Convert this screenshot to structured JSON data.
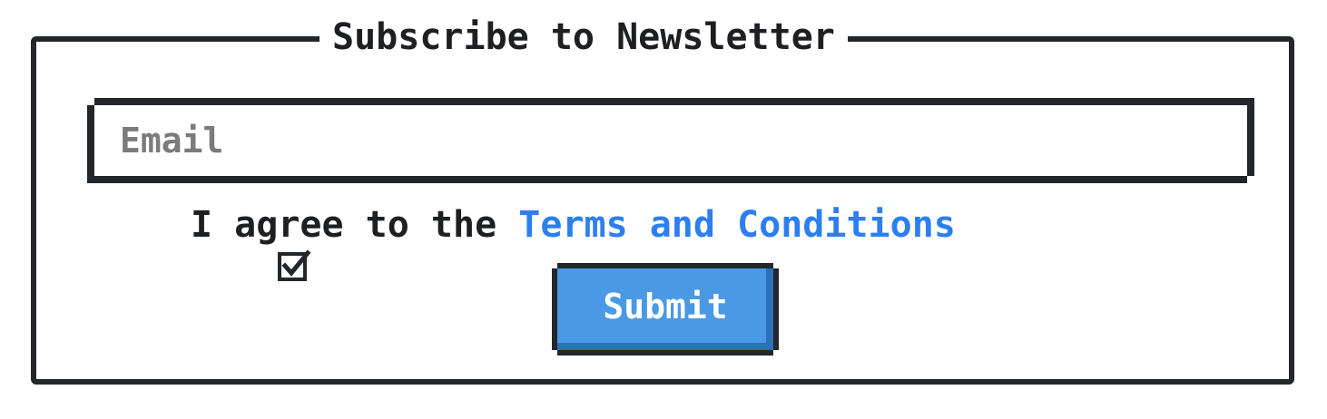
{
  "form": {
    "legend": "Subscribe to Newsletter",
    "email": {
      "placeholder": "Email",
      "value": ""
    },
    "agree": {
      "checked": true,
      "text_prefix": "I agree to the ",
      "link_text": "Terms and Conditions"
    },
    "submit_label": "Submit"
  },
  "colors": {
    "border": "#23262b",
    "link": "#2d7ff0",
    "button": "#4a99e4",
    "button_shade": "#2d6fb8",
    "placeholder": "#7b7b7b"
  },
  "icons": {
    "checkbox": "checked-checkbox-icon"
  }
}
